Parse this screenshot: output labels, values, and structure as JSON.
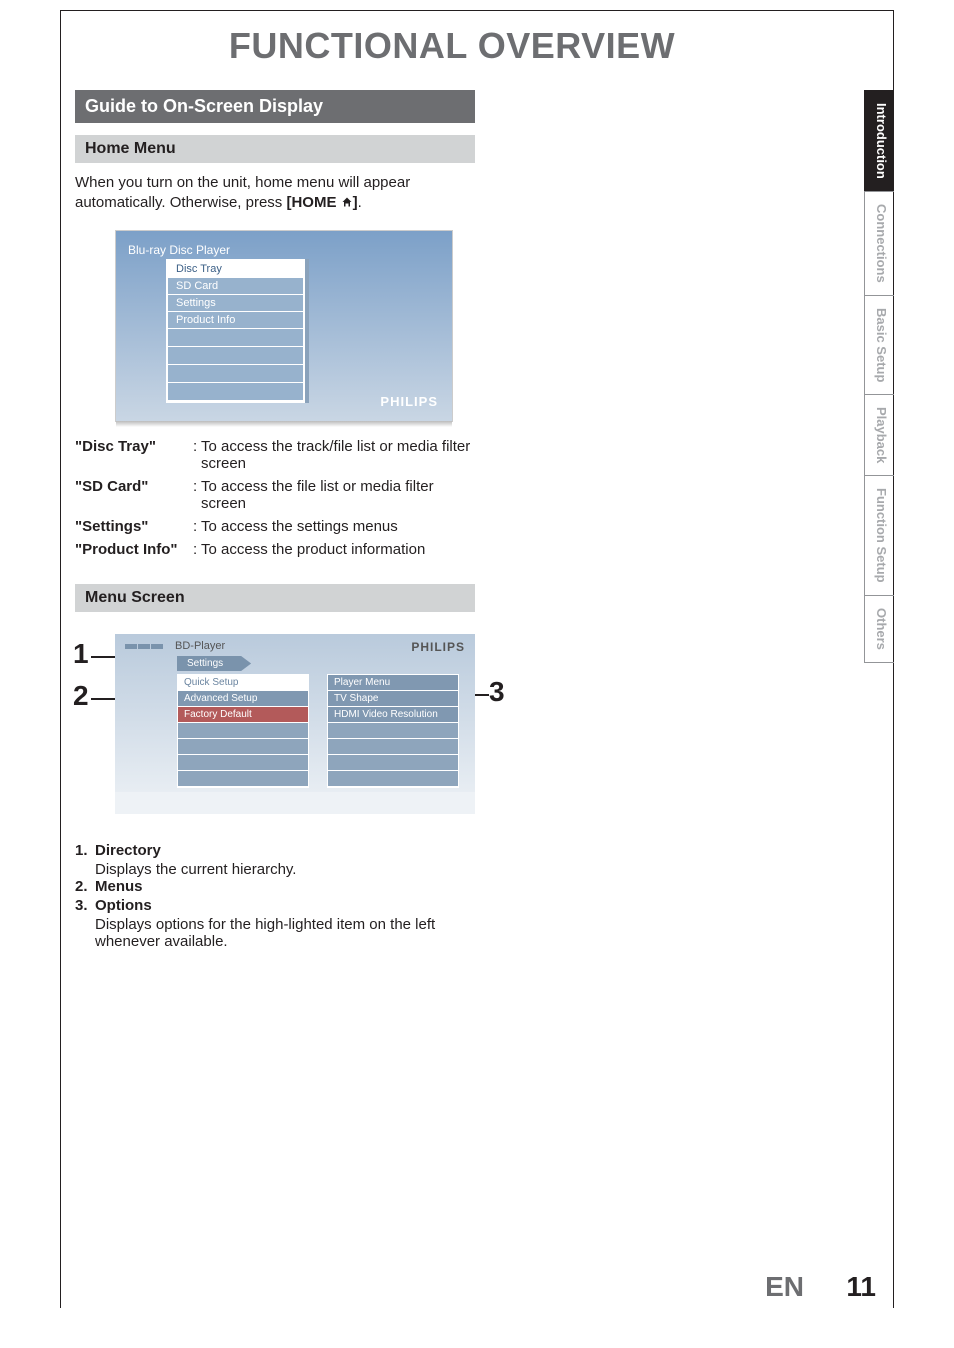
{
  "page": {
    "title": "FUNCTIONAL OVERVIEW",
    "language": "EN",
    "number": "11"
  },
  "tabs": [
    {
      "label": "Introduction",
      "active": true
    },
    {
      "label": "Connections",
      "active": false
    },
    {
      "label": "Basic Setup",
      "active": false
    },
    {
      "label": "Playback",
      "active": false
    },
    {
      "label": "Function Setup",
      "active": false
    },
    {
      "label": "Others",
      "active": false
    }
  ],
  "section_bar": "Guide to On-Screen Display",
  "home_section": {
    "heading": "Home Menu",
    "intro_a": "When you turn on the unit, home menu will appear automatically. Otherwise, press ",
    "intro_b_bold": "[HOME ",
    "intro_c_bold_after_icon": "]",
    "intro_d": ".",
    "screen": {
      "title": "Blu-ray Disc Player",
      "items": [
        "Disc Tray",
        "SD Card",
        "Settings",
        "Product Info"
      ],
      "brand": "PHILIPS"
    },
    "defs": [
      {
        "term": "\"Disc Tray\"",
        "desc": "To access the track/file list or media filter screen"
      },
      {
        "term": "\"SD Card\"",
        "desc": "To access the file list or media filter screen"
      },
      {
        "term": "\"Settings\"",
        "desc": "To access the settings menus"
      },
      {
        "term": "\"Product Info\"",
        "desc": "To access the product information"
      }
    ]
  },
  "menu_section": {
    "heading": "Menu Screen",
    "callouts": {
      "c1": "1",
      "c2": "2",
      "c3": "3"
    },
    "screen": {
      "header": "BD-Player",
      "brand": "PHILIPS",
      "crumb": "Settings",
      "colA": [
        "Quick Setup",
        "Advanced Setup",
        "Factory Default"
      ],
      "colB": [
        "Player Menu",
        "TV Shape",
        "HDMI Video Resolution"
      ]
    },
    "list": [
      {
        "n": "1.",
        "t": "Directory",
        "sub": "Displays the current hierarchy."
      },
      {
        "n": "2.",
        "t": "Menus",
        "sub": null
      },
      {
        "n": "3.",
        "t": "Options",
        "sub": "Displays options for the high-lighted item on the left whenever available."
      }
    ]
  }
}
